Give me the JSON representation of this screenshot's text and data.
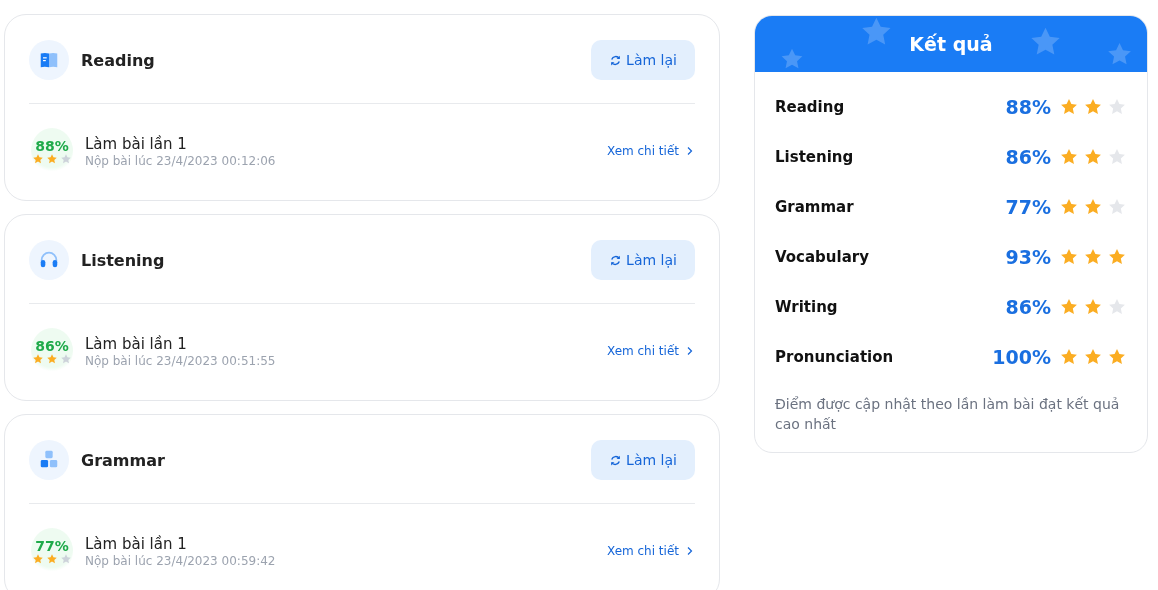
{
  "sections": [
    {
      "kind": "reading",
      "title": "Reading",
      "retry_button": "Làm lại",
      "attempts": [
        {
          "score": "88%",
          "stars": 2,
          "title": "Làm bài lần 1",
          "submitted": "Nộp bài lúc 23/4/2023 00:12:06",
          "detail_link": "Xem chi tiết"
        }
      ]
    },
    {
      "kind": "listening",
      "title": "Listening",
      "retry_button": "Làm lại",
      "attempts": [
        {
          "score": "86%",
          "stars": 2,
          "title": "Làm bài lần 1",
          "submitted": "Nộp bài lúc 23/4/2023 00:51:55",
          "detail_link": "Xem chi tiết"
        }
      ]
    },
    {
      "kind": "grammar",
      "title": "Grammar",
      "retry_button": "Làm lại",
      "attempts": [
        {
          "score": "77%",
          "stars": 2,
          "title": "Làm bài lần 1",
          "submitted": "Nộp bài lúc 23/4/2023 00:59:42",
          "detail_link": "Xem chi tiết"
        }
      ]
    }
  ],
  "results": {
    "title": "Kết quả",
    "rows": [
      {
        "skill": "Reading",
        "score": "88%",
        "stars": 2
      },
      {
        "skill": "Listening",
        "score": "86%",
        "stars": 2
      },
      {
        "skill": "Grammar",
        "score": "77%",
        "stars": 2
      },
      {
        "skill": "Vocabulary",
        "score": "93%",
        "stars": 3
      },
      {
        "skill": "Writing",
        "score": "86%",
        "stars": 2
      },
      {
        "skill": "Pronunciation",
        "score": "100%",
        "stars": 3
      }
    ],
    "note": "Điểm được cập nhật theo lần làm bài đạt kết quả cao nhất"
  }
}
